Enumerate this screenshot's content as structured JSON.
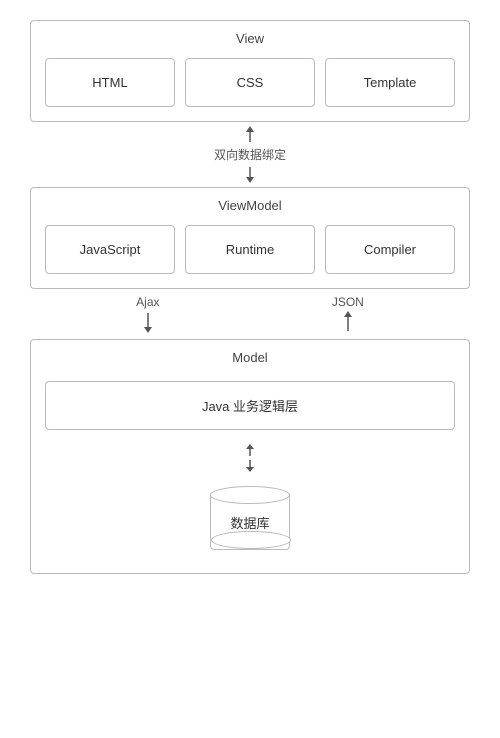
{
  "view": {
    "title": "View",
    "items": [
      "HTML",
      "CSS",
      "Template"
    ]
  },
  "connector_double": {
    "label": "双向数据绑定"
  },
  "viewmodel": {
    "title": "ViewModel",
    "items": [
      "JavaScript",
      "Runtime",
      "Compiler"
    ]
  },
  "connector_split": {
    "left_label": "Ajax",
    "right_label": "JSON"
  },
  "model": {
    "title": "Model",
    "java_label": "Java 业务逻辑层",
    "db_label": "数据库"
  },
  "colors": {
    "border": "#bbb",
    "text": "#333",
    "label": "#555",
    "bg": "#fff"
  }
}
